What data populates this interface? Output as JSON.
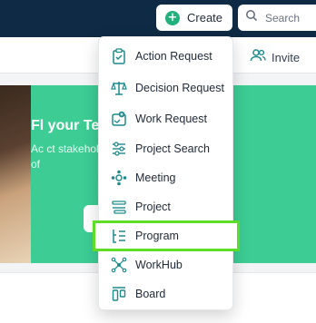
{
  "topbar": {
    "create_label": "Create",
    "search_placeholder": "Search"
  },
  "subbar": {
    "invite_label": "Invite"
  },
  "banner": {
    "headline": "Fl                  your Team!",
    "subtext_line1": "Ac                             ct stakeholde",
    "subtext_line2": "of"
  },
  "menu": {
    "items": [
      {
        "label": "Action Request",
        "icon": "clipboard-check-icon"
      },
      {
        "label": "Decision Request",
        "icon": "scale-icon"
      },
      {
        "label": "Work Request",
        "icon": "work-request-icon"
      },
      {
        "label": "Project Search",
        "icon": "sliders-icon"
      },
      {
        "label": "Meeting",
        "icon": "meeting-icon"
      },
      {
        "label": "Project",
        "icon": "project-icon"
      },
      {
        "label": "Program",
        "icon": "program-icon"
      },
      {
        "label": "WorkHub",
        "icon": "workhub-icon"
      },
      {
        "label": "Board",
        "icon": "board-icon"
      }
    ],
    "selected": "Program"
  },
  "colors": {
    "accent": "#22b07d",
    "icon": "#1e8a8a",
    "highlight": "#5fdc2a",
    "topbar": "#0f2a44",
    "banner": "#3ccc94"
  }
}
